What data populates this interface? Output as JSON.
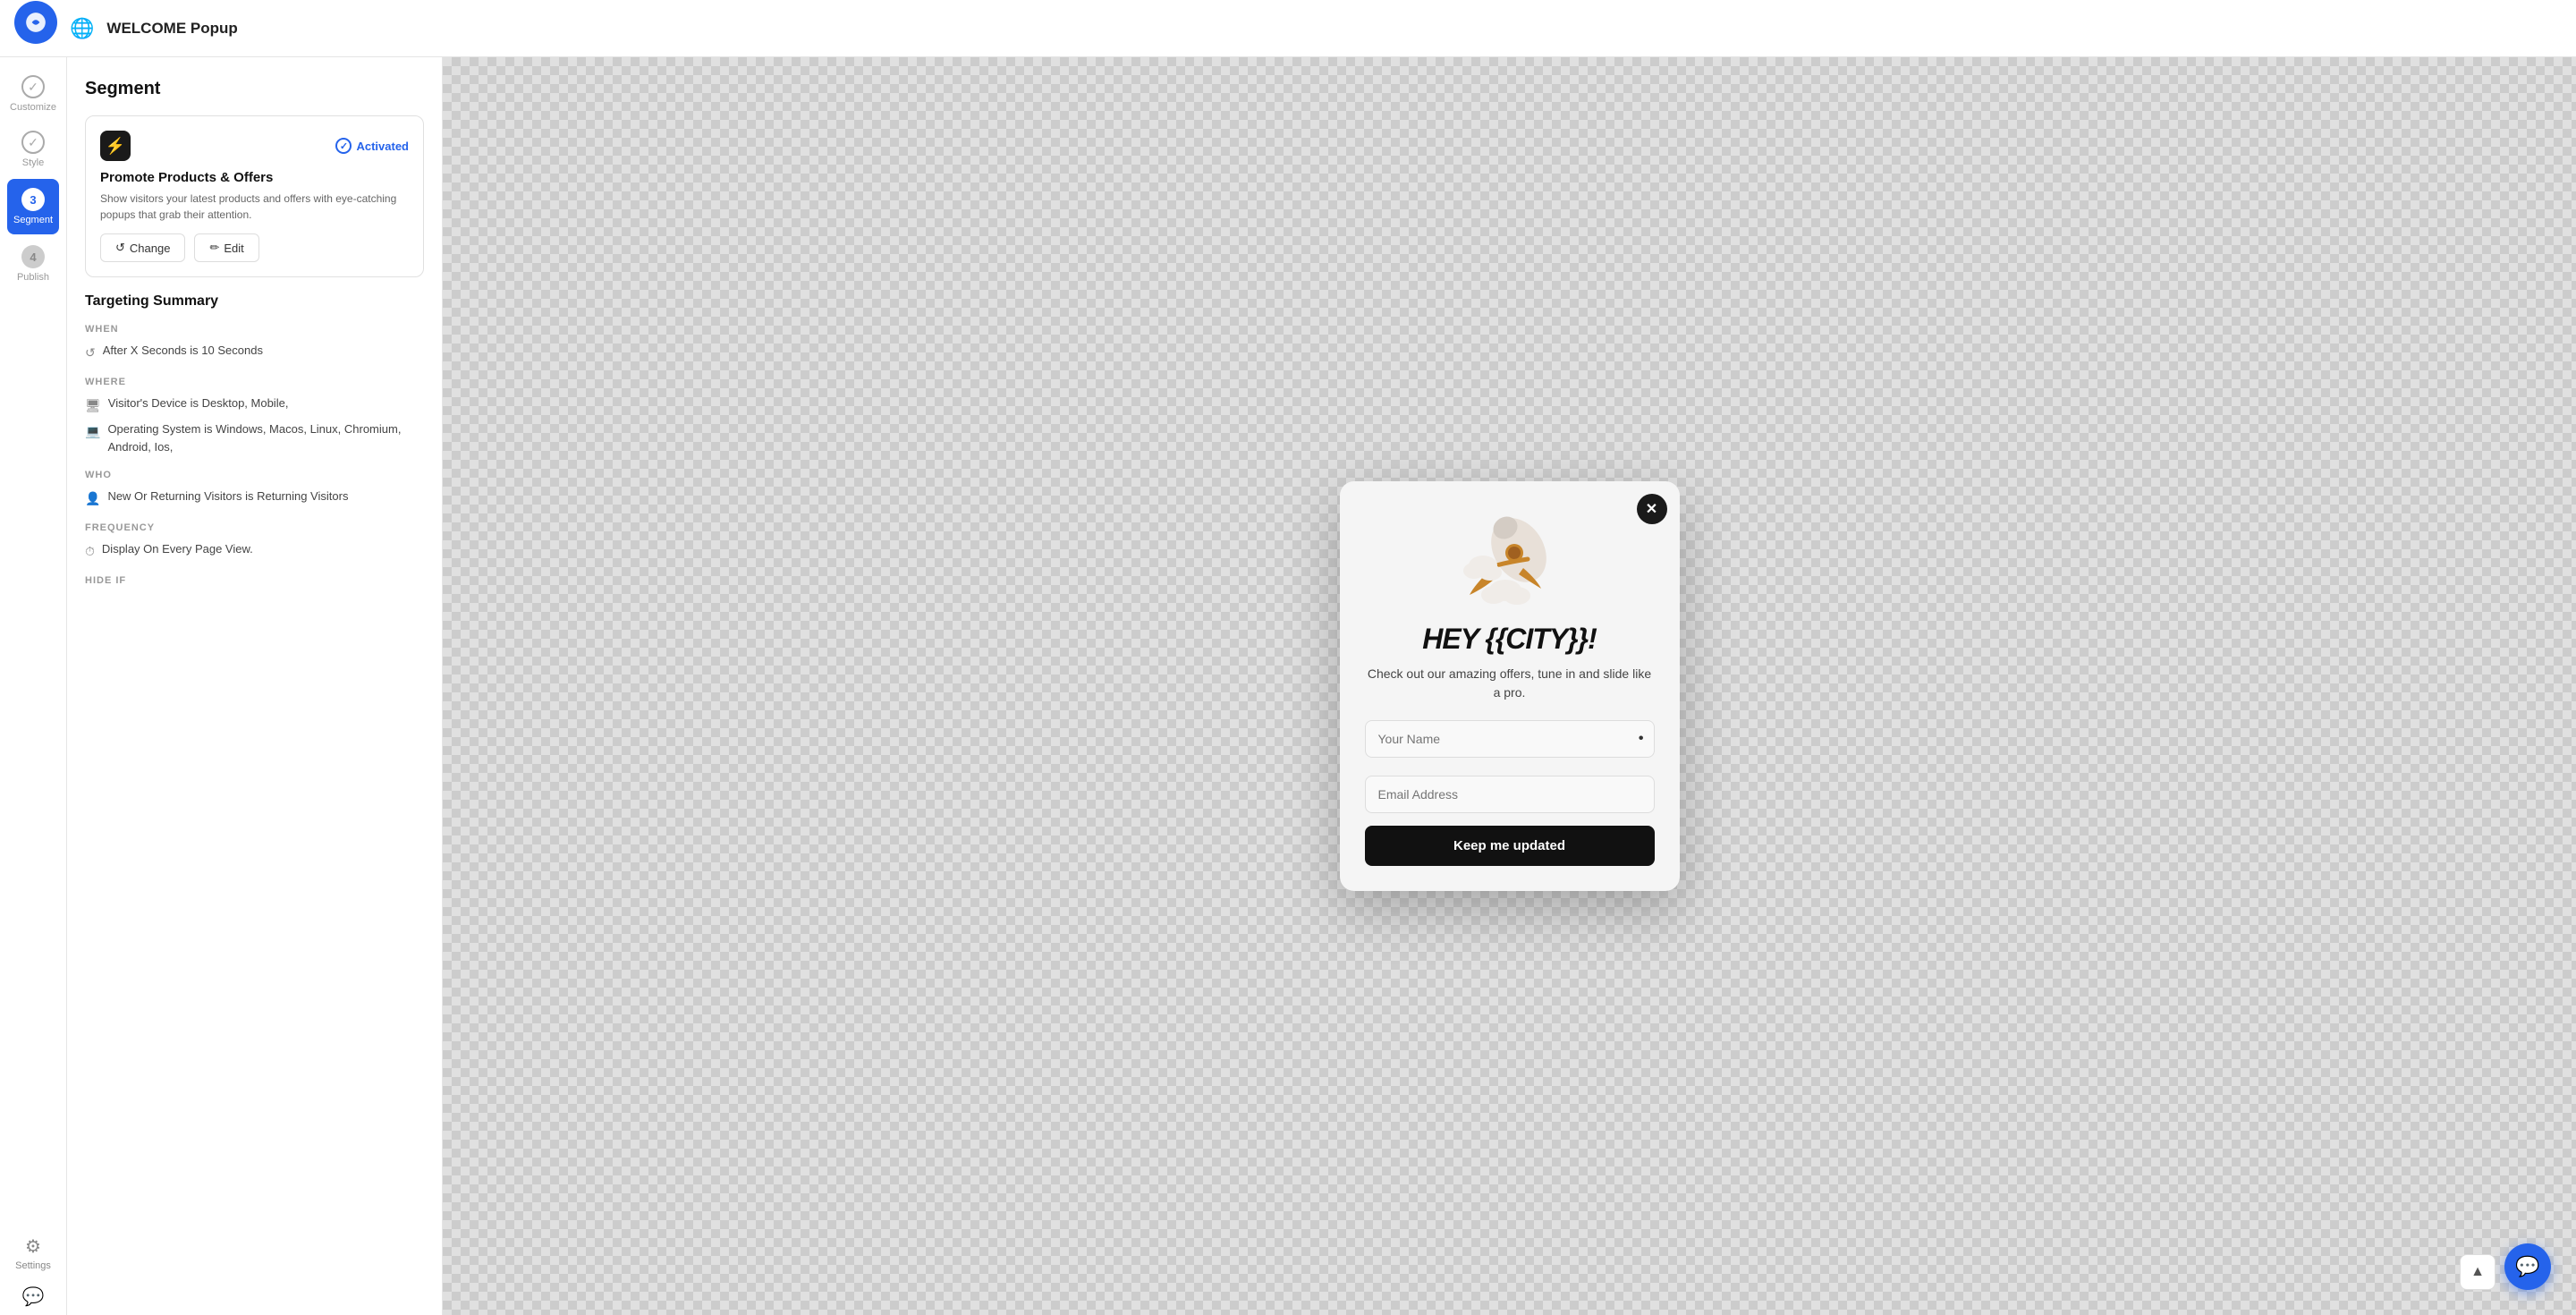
{
  "topbar": {
    "title": "WELCOME Popup",
    "globe_icon": "🌐"
  },
  "sidebar": {
    "logo_icon": "◎",
    "items": [
      {
        "id": "customize",
        "label": "Customize",
        "type": "check"
      },
      {
        "id": "style",
        "label": "Style",
        "type": "check"
      },
      {
        "id": "segment",
        "label": "Segment",
        "type": "number",
        "number": "3",
        "active": true
      },
      {
        "id": "publish",
        "label": "Publish",
        "type": "number",
        "number": "4"
      }
    ],
    "bottom_items": [
      {
        "id": "settings",
        "label": "Settings",
        "icon": "⚙"
      }
    ]
  },
  "segment_panel": {
    "title": "Segment",
    "goal_card": {
      "icon": "⚡",
      "activated_label": "Activated",
      "title": "Promote Products & Offers",
      "description": "Show visitors your latest products and offers with eye-catching popups that grab their attention.",
      "change_label": "Change",
      "edit_label": "Edit"
    },
    "targeting": {
      "title": "Targeting Summary",
      "sections": [
        {
          "label": "WHEN",
          "items": [
            {
              "icon": "↺",
              "text": "After X Seconds is 10 Seconds"
            }
          ]
        },
        {
          "label": "WHERE",
          "items": [
            {
              "icon": "🖥",
              "text": "Visitor's Device is Desktop, Mobile,"
            },
            {
              "icon": "💻",
              "text": "Operating System is Windows, Macos, Linux, Chromium, Android, Ios,"
            }
          ]
        },
        {
          "label": "WHO",
          "items": [
            {
              "icon": "👤",
              "text": "New Or Returning Visitors is Returning Visitors"
            }
          ]
        },
        {
          "label": "FREQUENCY",
          "items": [
            {
              "icon": "⏱",
              "text": "Display On Every Page View."
            }
          ]
        },
        {
          "label": "HIDE IF",
          "items": []
        }
      ]
    }
  },
  "popup": {
    "heading": "HEY {{CITY}}!",
    "subtext": "Check out our amazing offers, tune in and slide like a pro.",
    "name_placeholder": "Your Name",
    "email_placeholder": "Email Address",
    "button_label": "Keep me updated",
    "close_icon": "✕"
  }
}
